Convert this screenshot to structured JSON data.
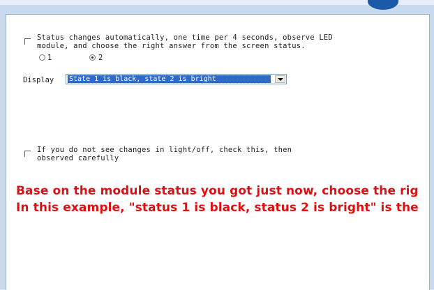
{
  "settings": {
    "auto_status_checkbox": {
      "checked": false,
      "line1": "Status changes automatically, one time per 4 seconds, observe LED",
      "line2": "module, and choose the right answer from the screen status."
    },
    "status_radios": [
      {
        "label": "1",
        "selected": false
      },
      {
        "label": "2",
        "selected": true
      }
    ],
    "display": {
      "label": "Display",
      "selected_value": "State 1 is black, state 2 is bright"
    },
    "no_change_checkbox": {
      "checked": false,
      "line1": "If you do not see changes in light/off,  check this, then",
      "line2": "observed carefully"
    }
  },
  "overlay": {
    "line1": "Base on the module status you got just now, choose the rig",
    "line2": "In this example, \"status 1 is black, status 2 is bright\" is the",
    "color": "#e01010"
  },
  "colors": {
    "selection": "#3169c6",
    "accent_blob": "#1a5aa8"
  }
}
